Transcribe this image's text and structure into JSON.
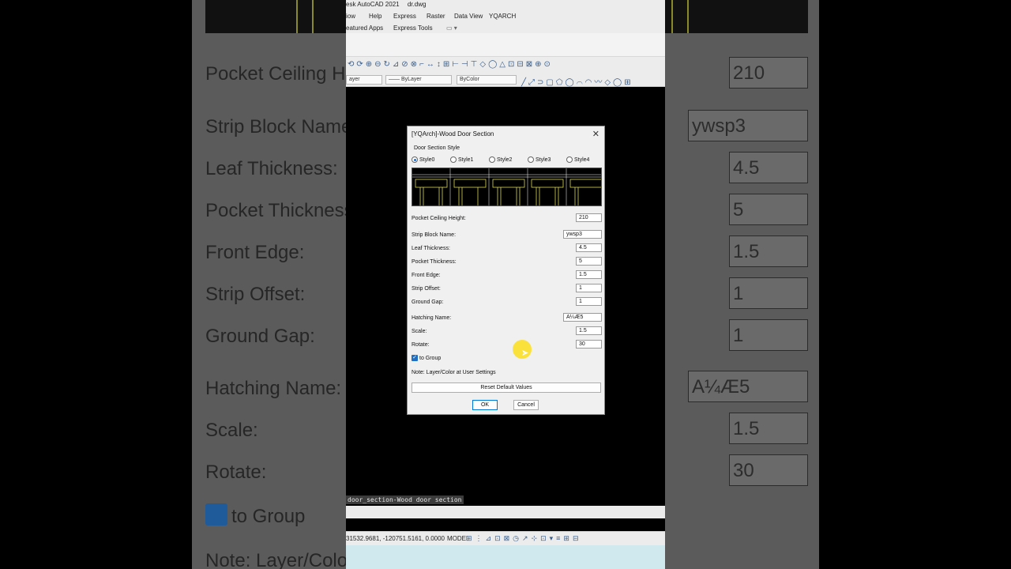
{
  "background": {
    "labels": [
      "Pocket Ceiling He",
      "Strip Block Name:",
      "Leaf Thickness:",
      "Pocket Thickness",
      "Front Edge:",
      "Strip Offset:",
      "Ground Gap:",
      "Hatching Name:",
      "Scale:",
      "Rotate:",
      "to Group",
      "Note: Layer/Color"
    ],
    "values": [
      "210",
      "ywsp3",
      "4.5",
      "5",
      "1.5",
      "1",
      "1",
      "A¼Æ5",
      "1.5",
      "30"
    ]
  },
  "app": {
    "title_left": "esk AutoCAD 2021",
    "file": "dr.dwg",
    "menu": [
      "iow",
      "Help",
      "Express",
      "Raster",
      "Data View",
      "YQARCH"
    ],
    "tabs": [
      "eatured Apps",
      "Express Tools"
    ],
    "layer_drop": "ayer",
    "linetype_drop": "—— ByLayer",
    "color_drop": "ByColor",
    "command_echo": "door_section-Wood door section",
    "coords": "31532.9681, -120751.5161, 0.0000",
    "model": "MODEL"
  },
  "dialog": {
    "title": "[YQArch]-Wood Door Section",
    "close": "✕",
    "group_label": "Door Section Style",
    "styles": [
      "Style0",
      "Style1",
      "Style2",
      "Style3",
      "Style4"
    ],
    "selected_style": "Style0",
    "fields": {
      "pocket_ceiling_height": {
        "label": "Pocket Ceiling Height:",
        "value": "210"
      },
      "strip_block_name": {
        "label": "Strip Block Name:",
        "value": "ywsp3"
      },
      "leaf_thickness": {
        "label": "Leaf Thickness:",
        "value": "4.5"
      },
      "pocket_thickness": {
        "label": "Pocket Thickness:",
        "value": "5"
      },
      "front_edge": {
        "label": "Front Edge:",
        "value": "1.5"
      },
      "strip_offset": {
        "label": "Strip Offset:",
        "value": "1"
      },
      "ground_gap": {
        "label": "Ground Gap:",
        "value": "1"
      },
      "hatching_name": {
        "label": "Hatching Name:",
        "value": "A¼Æ5"
      },
      "scale": {
        "label": "Scale:",
        "value": "1.5"
      },
      "rotate": {
        "label": "Rotate:",
        "value": "30"
      }
    },
    "to_group": {
      "label": "to Group",
      "checked": true
    },
    "note": "Note: Layer/Color at User Settings",
    "reset_button": "Reset Default Values",
    "ok_button": "OK",
    "cancel_button": "Cancel"
  },
  "colors": {
    "accent": "#1f6fc5",
    "preview_lines": "#d8d84a"
  }
}
